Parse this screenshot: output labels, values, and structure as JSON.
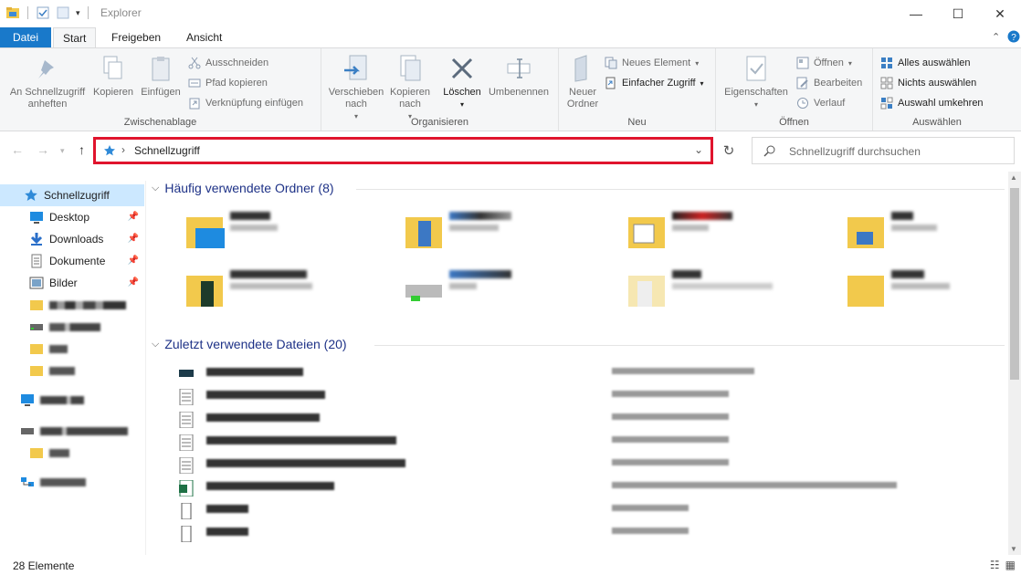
{
  "window": {
    "title": "Explorer",
    "controls": {
      "minimize": "—",
      "maximize": "☐",
      "close": "✕"
    }
  },
  "ribbon_tabs": [
    {
      "label": "Datei"
    },
    {
      "label": "Start"
    },
    {
      "label": "Freigeben"
    },
    {
      "label": "Ansicht"
    }
  ],
  "ribbon": {
    "clipboard": {
      "label": "Zwischenablage",
      "pin": "An Schnellzugriff anheften",
      "pin_line1": "An Schnellzugriff",
      "pin_line2": "anheften",
      "copy": "Kopieren",
      "paste": "Einfügen",
      "cut": "Ausschneiden",
      "copy_path": "Pfad kopieren",
      "paste_shortcut": "Verknüpfung einfügen"
    },
    "organize": {
      "label": "Organisieren",
      "move_line1": "Verschieben",
      "move_line2": "nach",
      "copy_line1": "Kopieren",
      "copy_line2": "nach",
      "delete": "Löschen",
      "rename": "Umbenennen"
    },
    "new": {
      "label": "Neu",
      "folder_line1": "Neuer",
      "folder_line2": "Ordner",
      "new_item": "Neues Element",
      "easy_access": "Einfacher Zugriff"
    },
    "open": {
      "label": "Öffnen",
      "properties": "Eigenschaften",
      "open": "Öffnen",
      "edit": "Bearbeiten",
      "history": "Verlauf"
    },
    "select": {
      "label": "Auswählen",
      "select_all": "Alles auswählen",
      "select_none": "Nichts auswählen",
      "invert": "Auswahl umkehren"
    }
  },
  "address": {
    "path": "Schnellzugriff",
    "search_placeholder": "Schnellzugriff durchsuchen"
  },
  "nav_pane": [
    {
      "label": "Schnellzugriff",
      "icon": "star-icon",
      "selected": true
    },
    {
      "label": "Desktop",
      "icon": "desktop-icon",
      "pinned": true
    },
    {
      "label": "Downloads",
      "icon": "download-icon",
      "pinned": true
    },
    {
      "label": "Dokumente",
      "icon": "documents-icon",
      "pinned": true
    },
    {
      "label": "Bilder",
      "icon": "pictures-icon",
      "pinned": true
    }
  ],
  "sections": {
    "frequent": "Häufig verwendete Ordner (8)",
    "recent": "Zuletzt verwendete Dateien (20)"
  },
  "status": {
    "count": "28 Elemente"
  }
}
